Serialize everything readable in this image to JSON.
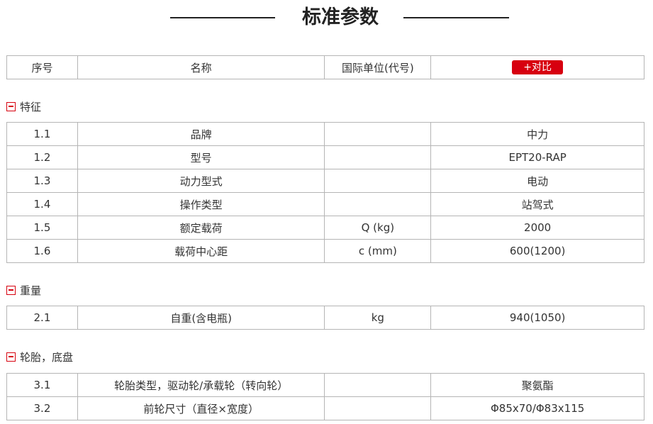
{
  "page_title": "标准参数",
  "header": {
    "col1": "序号",
    "col2": "名称",
    "col3": "国际单位(代号)",
    "compare_label": "+对比"
  },
  "sections": [
    {
      "title": "特征",
      "rows": [
        {
          "no": "1.1",
          "name": "品牌",
          "unit": "",
          "value": "中力"
        },
        {
          "no": "1.2",
          "name": "型号",
          "unit": "",
          "value": "EPT20-RAP"
        },
        {
          "no": "1.3",
          "name": "动力型式",
          "unit": "",
          "value": "电动"
        },
        {
          "no": "1.4",
          "name": "操作类型",
          "unit": "",
          "value": "站驾式"
        },
        {
          "no": "1.5",
          "name": "额定载荷",
          "unit": "Q (kg)",
          "value": "2000"
        },
        {
          "no": "1.6",
          "name": "载荷中心距",
          "unit": "c (mm)",
          "value": "600(1200)"
        }
      ]
    },
    {
      "title": "重量",
      "rows": [
        {
          "no": "2.1",
          "name": "自重(含电瓶)",
          "unit": "kg",
          "value": "940(1050)"
        }
      ]
    },
    {
      "title": "轮胎，底盘",
      "rows": [
        {
          "no": "3.1",
          "name": "轮胎类型，驱动轮/承载轮（转向轮）",
          "unit": "",
          "value": "聚氨酯"
        },
        {
          "no": "3.2",
          "name": "前轮尺寸（直径×宽度）",
          "unit": "",
          "value": "Φ85x70/Φ83x115"
        }
      ]
    }
  ],
  "colors": {
    "accent": "#d7000f",
    "border": "#b5b5b5"
  },
  "icons": {
    "section_toggle": "minus-icon"
  }
}
